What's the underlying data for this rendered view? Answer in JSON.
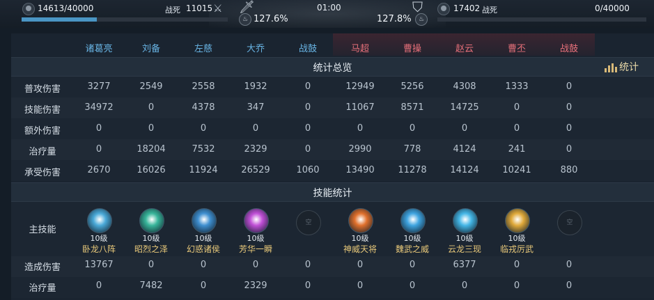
{
  "top": {
    "left_score": "14613/40000",
    "left_death_label": "战死",
    "left_death_count": "11015",
    "left_bar_fraction": 0.365,
    "left_percent": "127.6%",
    "time": "01:00",
    "right_percent": "127.8%",
    "right_score": "17402",
    "right_death_label": "战死",
    "right_total": "0/40000",
    "right_bar_fraction": 0.0
  },
  "heroes": [
    {
      "name": "诸葛亮",
      "side": "blue"
    },
    {
      "name": "刘备",
      "side": "blue"
    },
    {
      "name": "左慈",
      "side": "blue"
    },
    {
      "name": "大乔",
      "side": "blue"
    },
    {
      "name": "战鼓",
      "side": "blue"
    },
    {
      "name": "马超",
      "side": "red"
    },
    {
      "name": "曹操",
      "side": "red"
    },
    {
      "name": "赵云",
      "side": "red"
    },
    {
      "name": "曹丕",
      "side": "red"
    },
    {
      "name": "战鼓",
      "side": "red"
    }
  ],
  "sections": {
    "overview_title": "统计总览",
    "skills_title": "技能统计",
    "stats_button": "统计"
  },
  "overview_rows": [
    {
      "label": "普攻伤害",
      "values": [
        "3277",
        "2549",
        "2558",
        "1932",
        "0",
        "12949",
        "5256",
        "4308",
        "1333",
        "0"
      ]
    },
    {
      "label": "技能伤害",
      "values": [
        "34972",
        "0",
        "4378",
        "347",
        "0",
        "11067",
        "8571",
        "14725",
        "0",
        "0"
      ]
    },
    {
      "label": "额外伤害",
      "values": [
        "0",
        "0",
        "0",
        "0",
        "0",
        "0",
        "0",
        "0",
        "0",
        "0"
      ]
    },
    {
      "label": "治疗量",
      "values": [
        "0",
        "18204",
        "7532",
        "2329",
        "0",
        "2990",
        "778",
        "4124",
        "241",
        "0"
      ]
    },
    {
      "label": "承受伤害",
      "values": [
        "2670",
        "16026",
        "11924",
        "26529",
        "1060",
        "13490",
        "11278",
        "14124",
        "10241",
        "880"
      ]
    }
  ],
  "skills": {
    "main_label": "主技能",
    "empty_text": "空",
    "items": [
      {
        "level": "10级",
        "name": "卧龙八阵",
        "color": "#4aa9d8"
      },
      {
        "level": "10级",
        "name": "昭烈之泽",
        "color": "#38b59a"
      },
      {
        "level": "10级",
        "name": "幻惑诸侯",
        "color": "#3f8fd0"
      },
      {
        "level": "10级",
        "name": "芳华一瞬",
        "color": "#c04fd6"
      },
      {
        "level": "",
        "name": "",
        "color": ""
      },
      {
        "level": "10级",
        "name": "神威天将",
        "color": "#e0702c"
      },
      {
        "level": "10级",
        "name": "魏武之威",
        "color": "#3fa4e0"
      },
      {
        "level": "10级",
        "name": "云龙三现",
        "color": "#44b6e6"
      },
      {
        "level": "10级",
        "name": "临戎厉武",
        "color": "#e0a93a"
      },
      {
        "level": "",
        "name": "",
        "color": ""
      }
    ]
  },
  "skill_rows": [
    {
      "label": "造成伤害",
      "values": [
        "13767",
        "0",
        "0",
        "0",
        "0",
        "0",
        "0",
        "6377",
        "0",
        "0"
      ]
    },
    {
      "label": "治疗量",
      "values": [
        "0",
        "7482",
        "0",
        "2329",
        "0",
        "0",
        "0",
        "0",
        "0",
        "0"
      ]
    }
  ]
}
